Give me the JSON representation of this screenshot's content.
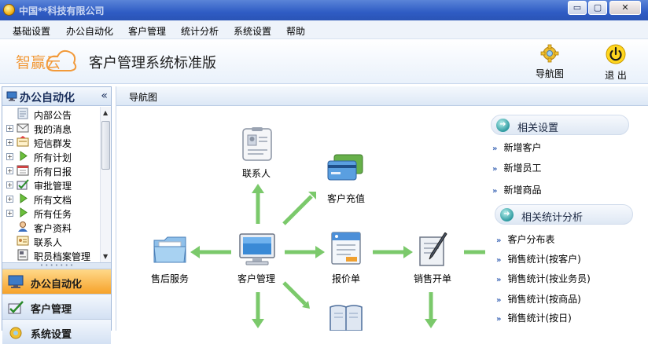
{
  "window": {
    "title": "中国**科技有限公司",
    "minimize": "▭",
    "maximize": "▢",
    "close": "✕"
  },
  "menu": [
    "基础设置",
    "办公自动化",
    "客户管理",
    "统计分析",
    "系统设置",
    "帮助"
  ],
  "header": {
    "logo_text": "智赢云",
    "app_title": "客户管理系统标准版",
    "nav_button": "导航图",
    "exit_button": "退 出"
  },
  "sidebar": {
    "title": "办公自动化",
    "collapse": "«",
    "tree": [
      {
        "label": "内部公告",
        "expandable": false,
        "icon": "notice-icon"
      },
      {
        "label": "我的消息",
        "expandable": true,
        "icon": "mail-icon"
      },
      {
        "label": "短信群发",
        "expandable": true,
        "icon": "sms-icon"
      },
      {
        "label": "所有计划",
        "expandable": true,
        "icon": "play-icon"
      },
      {
        "label": "所有日报",
        "expandable": true,
        "icon": "calendar-icon"
      },
      {
        "label": "审批管理",
        "expandable": true,
        "icon": "approve-icon"
      },
      {
        "label": "所有文档",
        "expandable": true,
        "icon": "play-icon"
      },
      {
        "label": "所有任务",
        "expandable": true,
        "icon": "play-icon"
      },
      {
        "label": "客户资料",
        "expandable": false,
        "icon": "customer-icon"
      },
      {
        "label": "联系人",
        "expandable": false,
        "icon": "contact-icon"
      },
      {
        "label": "职员档案管理",
        "expandable": false,
        "icon": "archive-icon"
      }
    ],
    "categories": [
      {
        "label": "办公自动化",
        "active": true
      },
      {
        "label": "客户管理",
        "active": false
      },
      {
        "label": "系统设置",
        "active": false
      }
    ]
  },
  "main": {
    "tab": "导航图",
    "flow": {
      "contact": "联系人",
      "recharge": "客户充值",
      "after_sales": "售后服务",
      "customer": "客户管理",
      "quote": "报价单",
      "sales_order": "销售开单"
    },
    "related_settings": {
      "title": "相关设置",
      "links": [
        "新增客户",
        "新增员工",
        "新增商品"
      ]
    },
    "related_stats": {
      "title": "相关统计分析",
      "links": [
        "客户分布表",
        "销售统计(按客户)",
        "销售统计(按业务员)",
        "销售统计(按商品)",
        "销售统计(按日)"
      ]
    }
  },
  "colors": {
    "arrow_green": "#7bc96b",
    "titlebar": "#2f5cc4",
    "active_category": "#f6a22a"
  }
}
